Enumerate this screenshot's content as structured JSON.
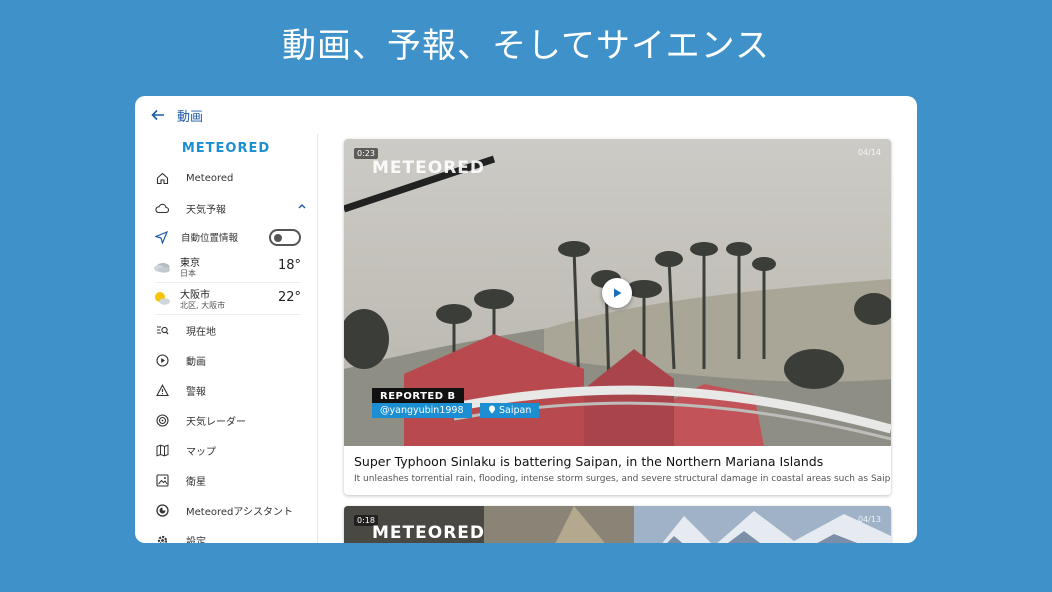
{
  "headline": "動画、予報、そしてサイエンス",
  "topbar": {
    "title": "動画"
  },
  "sidebar": {
    "logo": "METEORED",
    "items_top": [
      {
        "label": "Meteored",
        "icon": "home-icon"
      },
      {
        "label": "天気予報",
        "icon": "cloud-icon"
      }
    ],
    "auto_location": {
      "label": "自動位置情報",
      "enabled": false
    },
    "cities": [
      {
        "name": "東京",
        "region": "日本",
        "temp": "18°",
        "icon": "cloudy-icon"
      },
      {
        "name": "大阪市",
        "region": "北区, 大阪市",
        "temp": "22°",
        "icon": "partly-sunny-icon"
      }
    ],
    "items_bottom": [
      {
        "label": "現在地",
        "icon": "location-search-icon"
      },
      {
        "label": "動画",
        "icon": "play-circle-icon"
      },
      {
        "label": "警報",
        "icon": "warning-icon"
      },
      {
        "label": "天気レーダー",
        "icon": "radar-icon"
      },
      {
        "label": "マップ",
        "icon": "map-icon"
      },
      {
        "label": "衛星",
        "icon": "satellite-image-icon"
      },
      {
        "label": "Meteoredアシスタント",
        "icon": "assistant-icon"
      },
      {
        "label": "設定",
        "icon": "settings-icon"
      }
    ]
  },
  "videos": [
    {
      "duration": "0:23",
      "date": "04/14",
      "watermark": "METEORED",
      "reported_by": "REPORTED B",
      "user": "@yangyubin1998",
      "location": "Saipan",
      "title": "Super Typhoon Sinlaku is battering Saipan, in the Northern Mariana Islands",
      "description": "It unleashes torrential rain, flooding, intense storm surges, and severe structural damage in coastal areas such as Saipan."
    },
    {
      "duration": "0:18",
      "date": "04/13",
      "watermark": "METEORED"
    }
  ],
  "colors": {
    "background": "#3f92c9",
    "brand": "#1b8fd2",
    "accent": "#1a5aa8"
  }
}
